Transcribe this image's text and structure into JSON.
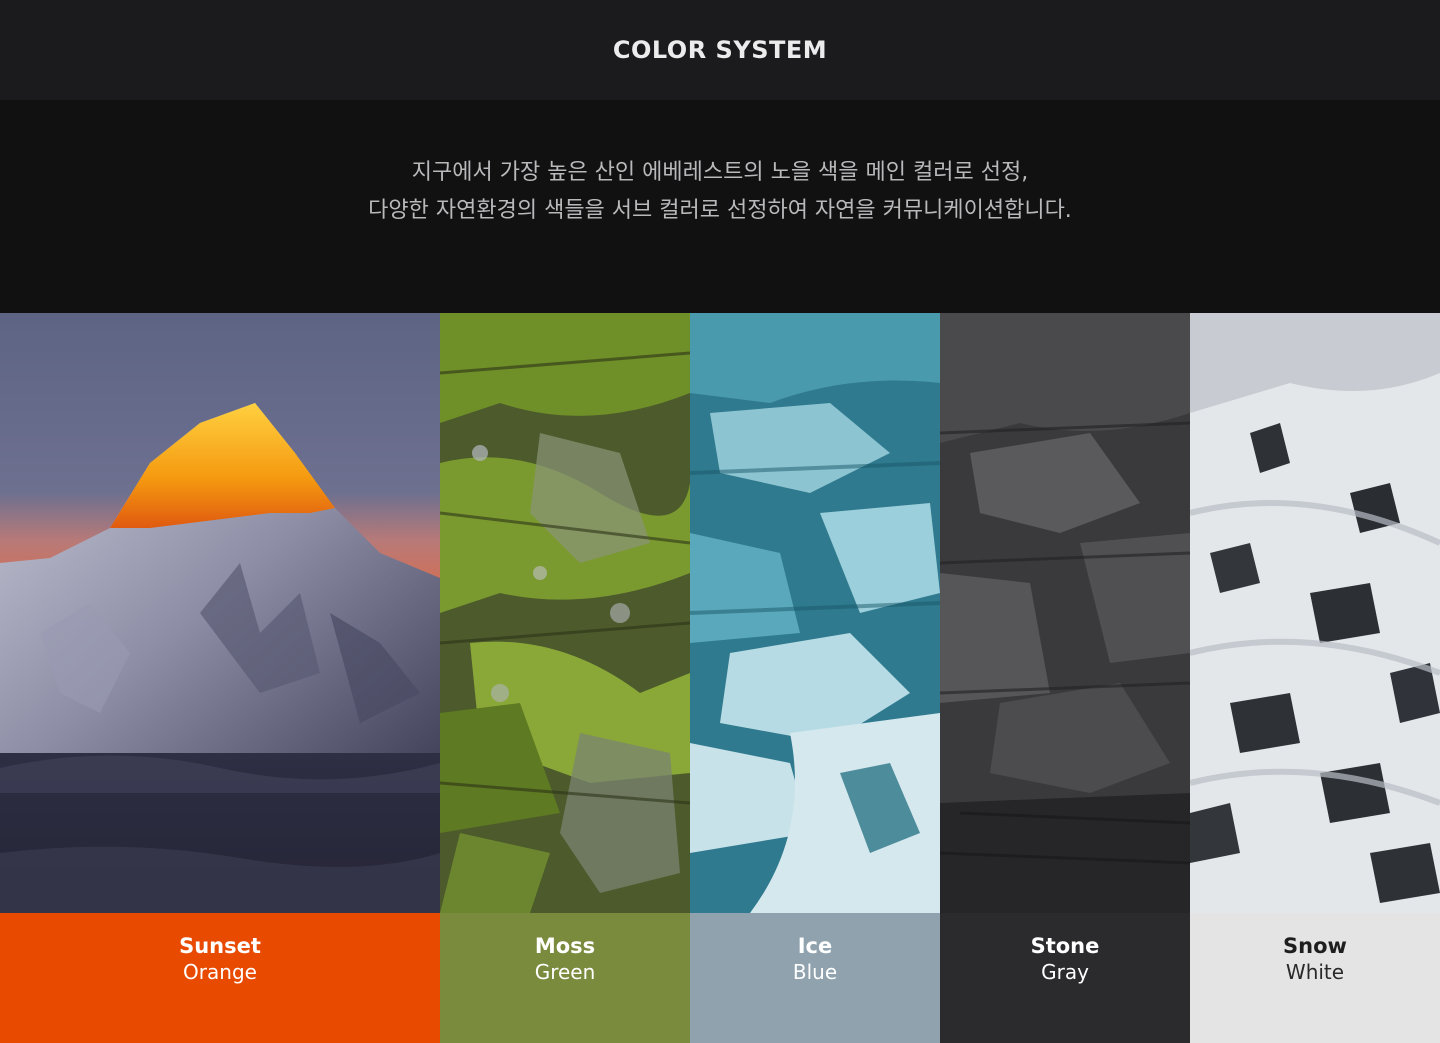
{
  "header": {
    "title": "COLOR SYSTEM"
  },
  "intro": {
    "lines": [
      "지구에서 가장 높은 산인 에베레스트의 노을 색을 메인 컬러로 선정,",
      "다양한 자연환경의 색들을 서브 컬러로 선정하여 자연을 커뮤니케이션합니다."
    ]
  },
  "swatches": [
    {
      "name": "Sunset",
      "color": "Orange",
      "hex": "#e84a00",
      "image": "mountain-sunset-photo"
    },
    {
      "name": "Moss",
      "color": "Green",
      "hex": "#7a8b3e",
      "image": "moss-rock-photo"
    },
    {
      "name": "Ice",
      "color": "Blue",
      "hex": "#8fa2ad",
      "image": "glacier-ice-photo"
    },
    {
      "name": "Stone",
      "color": "Gray",
      "hex": "#2b2b2e",
      "image": "dark-rock-photo"
    },
    {
      "name": "Snow",
      "color": "White",
      "hex": "#e4e4e4",
      "image": "snow-slope-photo"
    }
  ]
}
